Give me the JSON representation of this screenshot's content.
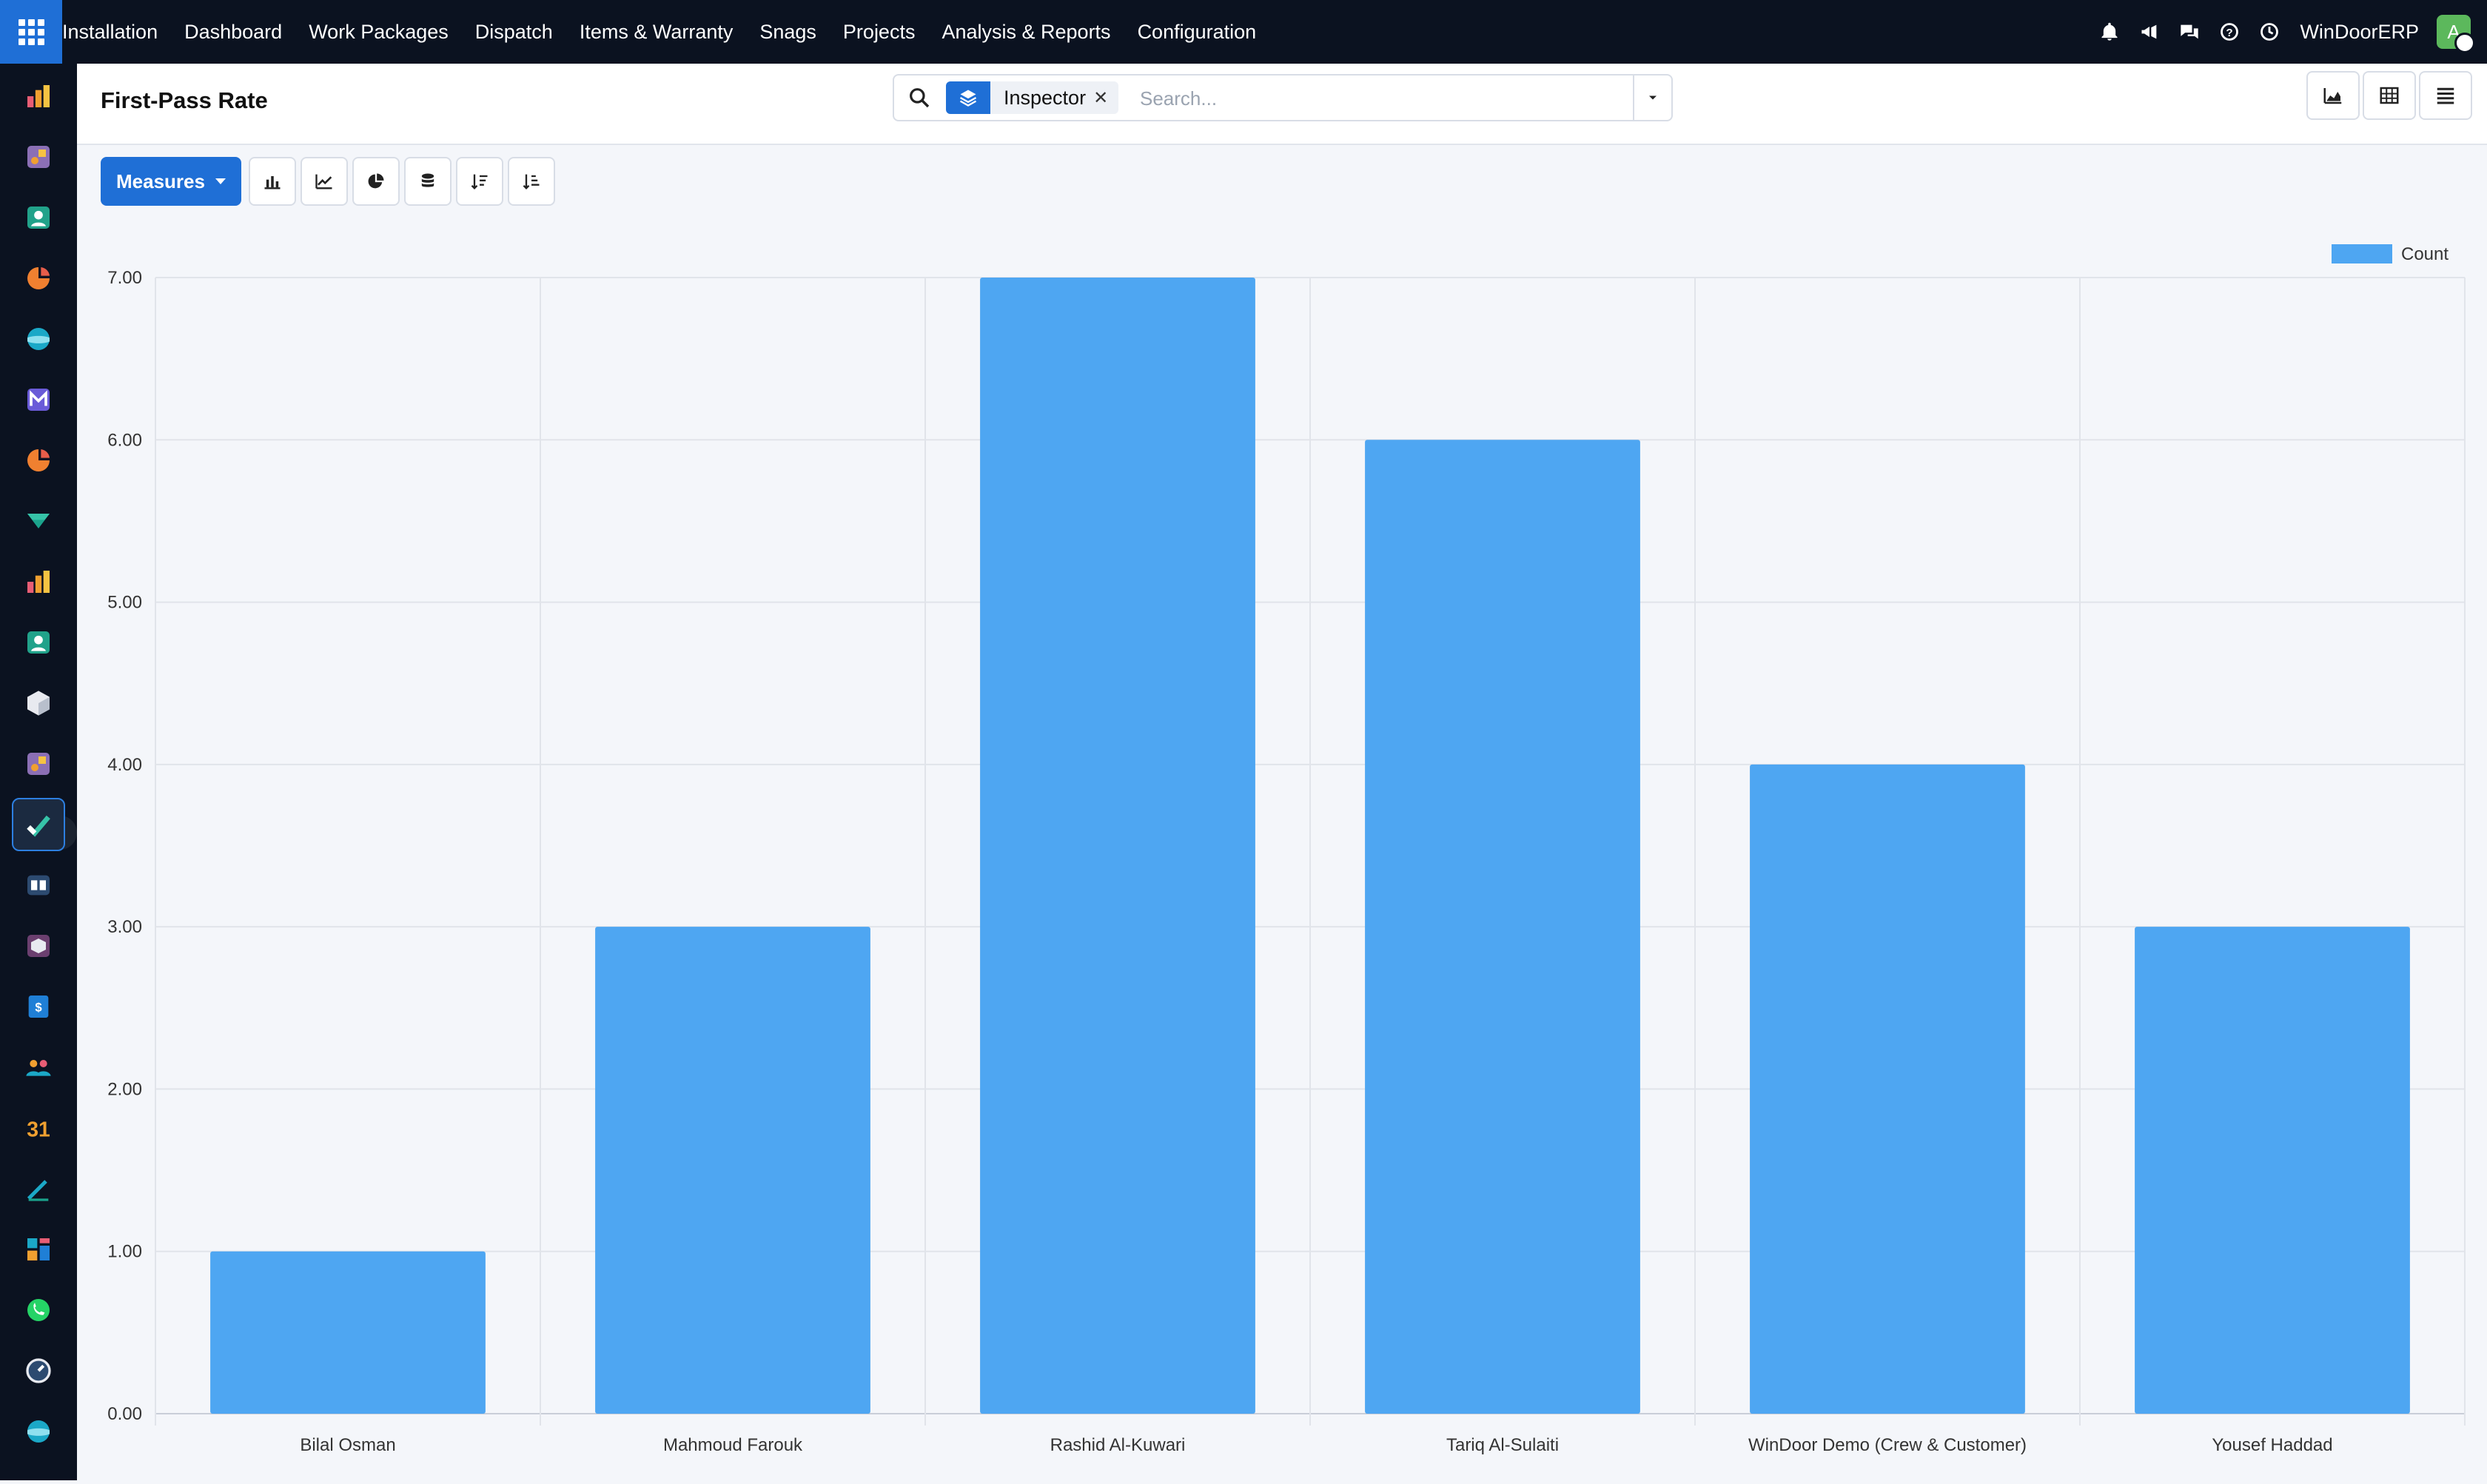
{
  "app": {
    "module": "Installation",
    "menu": [
      "Dashboard",
      "Work Packages",
      "Dispatch",
      "Items & Warranty",
      "Snags",
      "Projects",
      "Analysis & Reports",
      "Configuration"
    ],
    "company": "WinDoorERP",
    "user_initial": "A"
  },
  "view": {
    "title": "First-Pass Rate",
    "search": {
      "facet": "Inspector",
      "placeholder": "Search..."
    },
    "measures_label": "Measures"
  },
  "colors": {
    "bar": "#4ea6f2",
    "accent": "#1f6fd6",
    "topbar": "#0b1220"
  },
  "chart_data": {
    "type": "bar",
    "categories": [
      "Bilal Osman",
      "Mahmoud Farouk",
      "Rashid Al-Kuwari",
      "Tariq Al-Sulaiti",
      "WinDoor Demo (Crew & Customer)",
      "Yousef Haddad"
    ],
    "series": [
      {
        "name": "Count",
        "values": [
          1,
          3,
          7,
          6,
          4,
          3
        ]
      }
    ],
    "yticks": [
      "0.00",
      "1.00",
      "2.00",
      "3.00",
      "4.00",
      "5.00",
      "6.00",
      "7.00"
    ],
    "ylim": [
      0,
      7
    ],
    "grid": true,
    "legend": "top-right"
  }
}
